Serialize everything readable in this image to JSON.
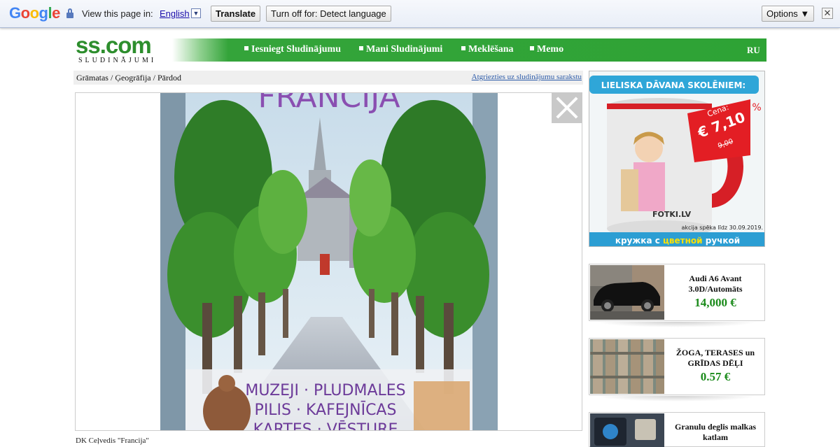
{
  "translate_bar": {
    "logo": "Google",
    "view_text": "View this page in:",
    "language": "English",
    "dropdown_glyph": "▼",
    "translate_label": "Translate",
    "turn_off_label": "Turn off for: Detect language",
    "options_label": "Options ▼",
    "close_glyph": "✕",
    "colors": {
      "blue": "#4285f4",
      "red": "#ea4335",
      "yellow": "#fbbc05",
      "green": "#34a853"
    }
  },
  "site": {
    "logo_main": "ss.com",
    "logo_sub": "SLUDINĀJUMI",
    "nav": [
      "Iesniegt Sludinājumu",
      "Mani Sludinājumi",
      "Meklēšana",
      "Memo"
    ],
    "lang_switch": "RU",
    "accent": "#2ea335"
  },
  "breadcrumb": {
    "path": "Grāmatas / Ģeogrāfija / Pārdod",
    "back_link": "Atgriezties uz sludinājumu sarakstu"
  },
  "photo": {
    "title_letters": "FRANCIJA",
    "lines": [
      "MUZEJI · PLUDMALES",
      "PILIS · KAFEJNĪCAS",
      "KARTES · VĒSTURE"
    ]
  },
  "caption": "DK Ceļvedis \"Francija\"",
  "promo": {
    "headline": "LIELISKA DĀVANA SKOLĒNIEM:",
    "discount": "-20 %",
    "price_label": "Cena:",
    "price": "€ 7,10",
    "old_price": "9,00",
    "brand": "FOTKI.LV",
    "valid": "akcija spēka līdz 30.09.2019.",
    "footer_pre": "кружка с ",
    "footer_hl": "цветной",
    "footer_post": " ручкой"
  },
  "ads": [
    {
      "title": "Audi A6 Avant 3.0D/Automāts",
      "price": "14,000 €"
    },
    {
      "title": "ŽOGA, TERASES un GRĪDAS DĒĻI",
      "price": "0.57 €"
    },
    {
      "title": "Granulu deglis malkas katlam",
      "price": ""
    }
  ]
}
